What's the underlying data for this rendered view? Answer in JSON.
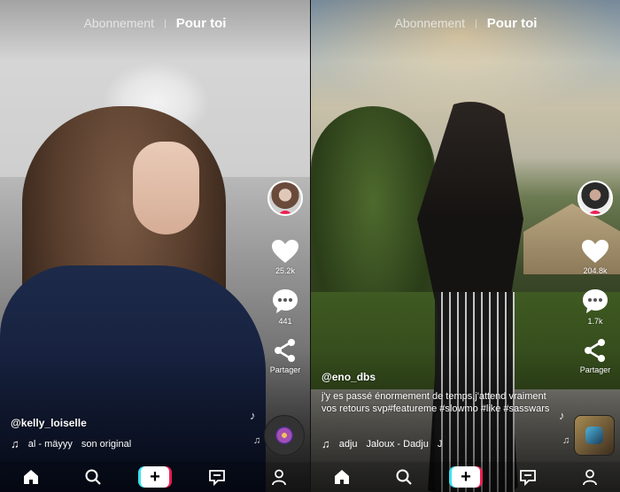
{
  "screens": [
    {
      "top_tabs": {
        "following": "Abonnement",
        "for_you": "Pour toi"
      },
      "rail": {
        "likes": "25.2k",
        "comments": "441",
        "share": "Partager"
      },
      "username": "@kelly_loiselle",
      "caption": "",
      "music": {
        "track": "al - mäyyy",
        "title": "son original"
      }
    },
    {
      "top_tabs": {
        "following": "Abonnement",
        "for_you": "Pour toi"
      },
      "rail": {
        "likes": "204.8k",
        "comments": "1.7k",
        "share": "Partager"
      },
      "username": "@eno_dbs",
      "caption": "j'y es passé énormement de temps,j'attend vraiment vos retours svp#featureme #slowmo #like #sasswars",
      "music": {
        "track": "adju",
        "title": "Jaloux - Dadju",
        "extra": "J"
      }
    }
  ],
  "nav": {
    "icons": [
      "home-icon",
      "search-icon",
      "add-icon",
      "inbox-icon",
      "profile-icon"
    ],
    "add_label": "+"
  },
  "colors": {
    "tiktok_red": "#ee1d52",
    "tiktok_cyan": "#3be3f0"
  }
}
